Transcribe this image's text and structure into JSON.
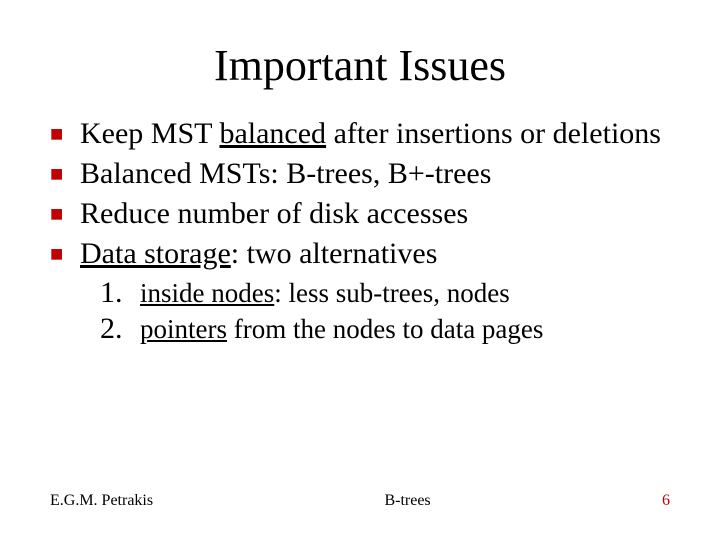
{
  "title": "Important Issues",
  "bullets": {
    "b1": {
      "pretext": "Keep MST ",
      "underlined": "balanced",
      "posttext": " after insertions or deletions"
    },
    "b2": {
      "text": "Balanced MSTs: B-trees, B+-trees"
    },
    "b3": {
      "text": "Reduce number of disk accesses"
    },
    "b4": {
      "underlined": "Data storage",
      "posttext": ": two alternatives"
    }
  },
  "sublist": {
    "s1": {
      "num": "1.",
      "underlined": "inside nodes",
      "posttext": ": less sub-trees, nodes"
    },
    "s2": {
      "num": "2.",
      "underlined": "pointers",
      "posttext": " from the nodes to data pages"
    }
  },
  "footer": {
    "left": "E.G.M. Petrakis",
    "center": "B-trees",
    "right": "6"
  },
  "bullet_glyph": "■"
}
